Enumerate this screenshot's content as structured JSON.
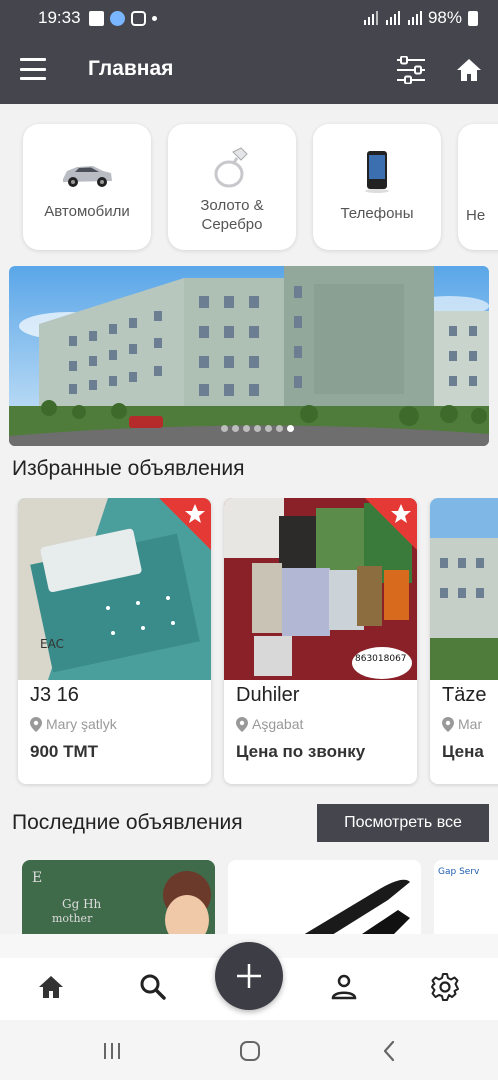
{
  "status_bar": {
    "time": "19:33",
    "battery": "98%",
    "icons": [
      "gallery-icon",
      "telegram-icon",
      "instagram-icon",
      "notification-dot"
    ]
  },
  "app_bar": {
    "title": "Главная",
    "icons": [
      "menu-icon",
      "filter-icon",
      "home-icon"
    ]
  },
  "categories": [
    {
      "label": "Автомобили",
      "icon": "car-icon"
    },
    {
      "label": "Золото &\nСеребро",
      "icon": "ring-icon"
    },
    {
      "label": "Телефоны",
      "icon": "phone-icon"
    },
    {
      "label": "Не",
      "icon": "building-icon"
    }
  ],
  "banner": {
    "slide_count": 7,
    "active_slide": 6
  },
  "featured": {
    "title": "Избранные объявления",
    "items": [
      {
        "title": "J3 16",
        "location": "Mary şatlyk",
        "price": "900 TMT"
      },
      {
        "title": "Duhiler",
        "location": "Aşgabat",
        "price": "Цена по звонку",
        "image_caption": "863018067"
      },
      {
        "title": "Täze",
        "location": "Mar",
        "price": "Цена"
      }
    ]
  },
  "latest": {
    "title": "Последние объявления",
    "see_all_label": "Посмотреть все"
  },
  "bottom_nav": {
    "items": [
      "home-icon",
      "search-icon",
      "add-icon",
      "profile-icon",
      "settings-icon"
    ]
  },
  "colors": {
    "primary": "#45454d",
    "badge": "#e53935",
    "background": "#f2f2f2"
  }
}
